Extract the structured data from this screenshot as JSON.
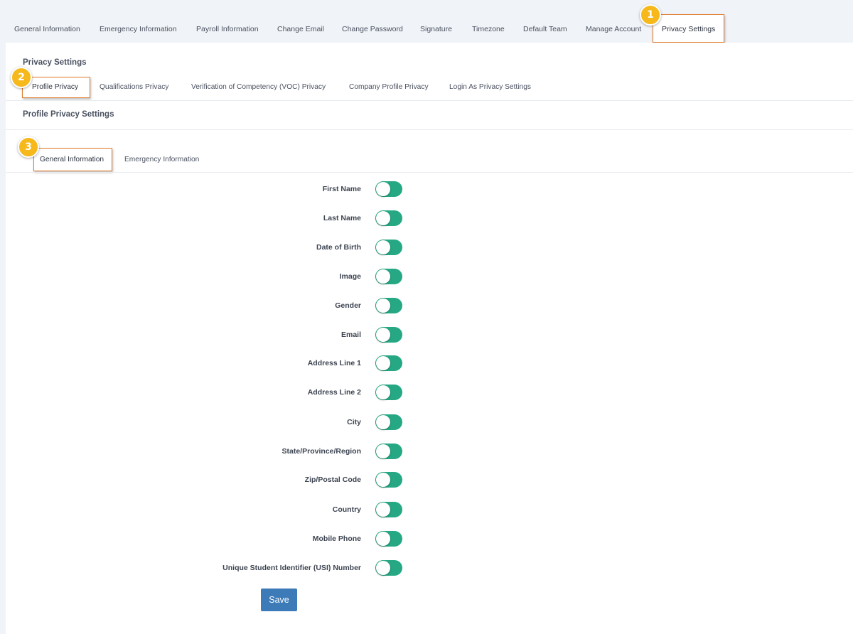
{
  "top_tabs": [
    {
      "label": "General Information"
    },
    {
      "label": "Emergency Information"
    },
    {
      "label": "Payroll Information"
    },
    {
      "label": "Change Email"
    },
    {
      "label": "Change Password"
    },
    {
      "label": "Signature"
    },
    {
      "label": "Timezone"
    },
    {
      "label": "Default Team"
    },
    {
      "label": "Manage Account"
    },
    {
      "label": "Privacy Settings",
      "active": true
    }
  ],
  "privacy_heading": "Privacy Settings",
  "privacy_tabs": [
    {
      "label": "Profile Privacy",
      "active": true
    },
    {
      "label": "Qualifications Privacy"
    },
    {
      "label": "Verification of Competency (VOC) Privacy"
    },
    {
      "label": "Company Profile Privacy"
    },
    {
      "label": "Login As Privacy Settings"
    }
  ],
  "profile_heading": "Profile Privacy Settings",
  "profile_tabs": [
    {
      "label": "General Information",
      "active": true
    },
    {
      "label": "Emergency Information"
    }
  ],
  "badges": [
    "1",
    "2",
    "3"
  ],
  "fields": [
    {
      "label": "First Name"
    },
    {
      "label": "Last Name"
    },
    {
      "label": "Date of Birth"
    },
    {
      "label": "Image"
    },
    {
      "label": "Gender"
    },
    {
      "label": "Email"
    },
    {
      "label": "Address Line 1"
    },
    {
      "label": "Address Line 2"
    },
    {
      "label": "City"
    },
    {
      "label": "State/Province/Region"
    },
    {
      "label": "Zip/Postal Code"
    },
    {
      "label": "Country"
    },
    {
      "label": "Mobile Phone"
    },
    {
      "label": "Unique Student Identifier (USI) Number"
    }
  ],
  "save_label": "Save",
  "colors": {
    "toggle_on": "#25a883",
    "save_button": "#3c7ab8",
    "highlight_border": "#e07b2c",
    "badge": "#f6b81a"
  }
}
